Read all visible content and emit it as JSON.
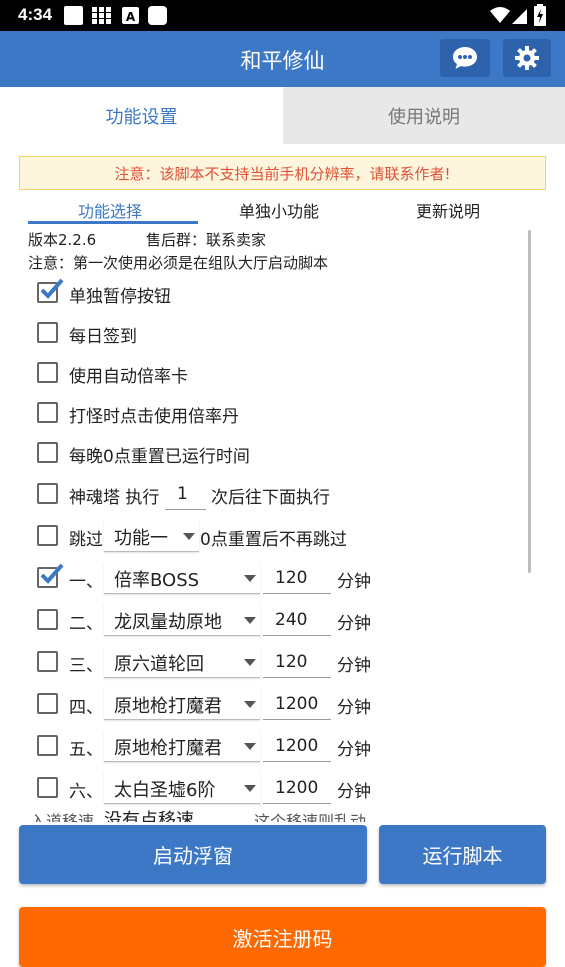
{
  "status_bar": {
    "time": "4:34"
  },
  "app": {
    "title": "和平修仙"
  },
  "tabs": [
    {
      "label": "功能设置",
      "active": true
    },
    {
      "label": "使用说明",
      "active": false
    }
  ],
  "notice": "注意：该脚本不支持当前手机分辨率，请联系作者!",
  "subtabs": [
    {
      "label": "功能选择",
      "active": true
    },
    {
      "label": "单独小功能",
      "active": false
    },
    {
      "label": "更新说明",
      "active": false
    }
  ],
  "info": {
    "version": "版本2.2.6",
    "group": "售后群：联系卖家",
    "warning": "注意：第一次使用必须是在组队大厅启动脚本"
  },
  "options": [
    {
      "label": "单独暂停按钮",
      "checked": true
    },
    {
      "label": "每日签到",
      "checked": false
    },
    {
      "label": "使用自动倍率卡",
      "checked": false
    },
    {
      "label": "打怪时点击使用倍率丹",
      "checked": false
    },
    {
      "label": "每晚0点重置已运行时间",
      "checked": false
    }
  ],
  "soul_tower": {
    "prefix": "神魂塔 执行",
    "value": "1",
    "suffix": "次后往下面执行",
    "checked": false
  },
  "skip": {
    "prefix": "跳过",
    "selected": "功能一",
    "suffix": "0点重置后不再跳过",
    "checked": false
  },
  "tasks": [
    {
      "index": "一、",
      "function": "倍率BOSS",
      "minutes": "120",
      "unit": "分钟",
      "checked": true
    },
    {
      "index": "二、",
      "function": "龙凤量劫原地",
      "minutes": "240",
      "unit": "分钟",
      "checked": false
    },
    {
      "index": "三、",
      "function": "原六道轮回",
      "minutes": "120",
      "unit": "分钟",
      "checked": false
    },
    {
      "index": "四、",
      "function": "原地枪打魔君",
      "minutes": "1200",
      "unit": "分钟",
      "checked": false
    },
    {
      "index": "五、",
      "function": "原地枪打魔君",
      "minutes": "1200",
      "unit": "分钟",
      "checked": false
    },
    {
      "index": "六、",
      "function": "太白圣墟6阶",
      "minutes": "1200",
      "unit": "分钟",
      "checked": false
    }
  ],
  "partial_row": {
    "prefix": "入道移速",
    "selected": "没有点移速",
    "suffix": "这个移速则乱动"
  },
  "buttons": {
    "float_window": "启动浮窗",
    "run_script": "运行脚本",
    "activate": "激活注册码"
  },
  "colors": {
    "primary": "#3d78c6",
    "activate": "#ff6a00",
    "notice_text": "#e0513a"
  }
}
